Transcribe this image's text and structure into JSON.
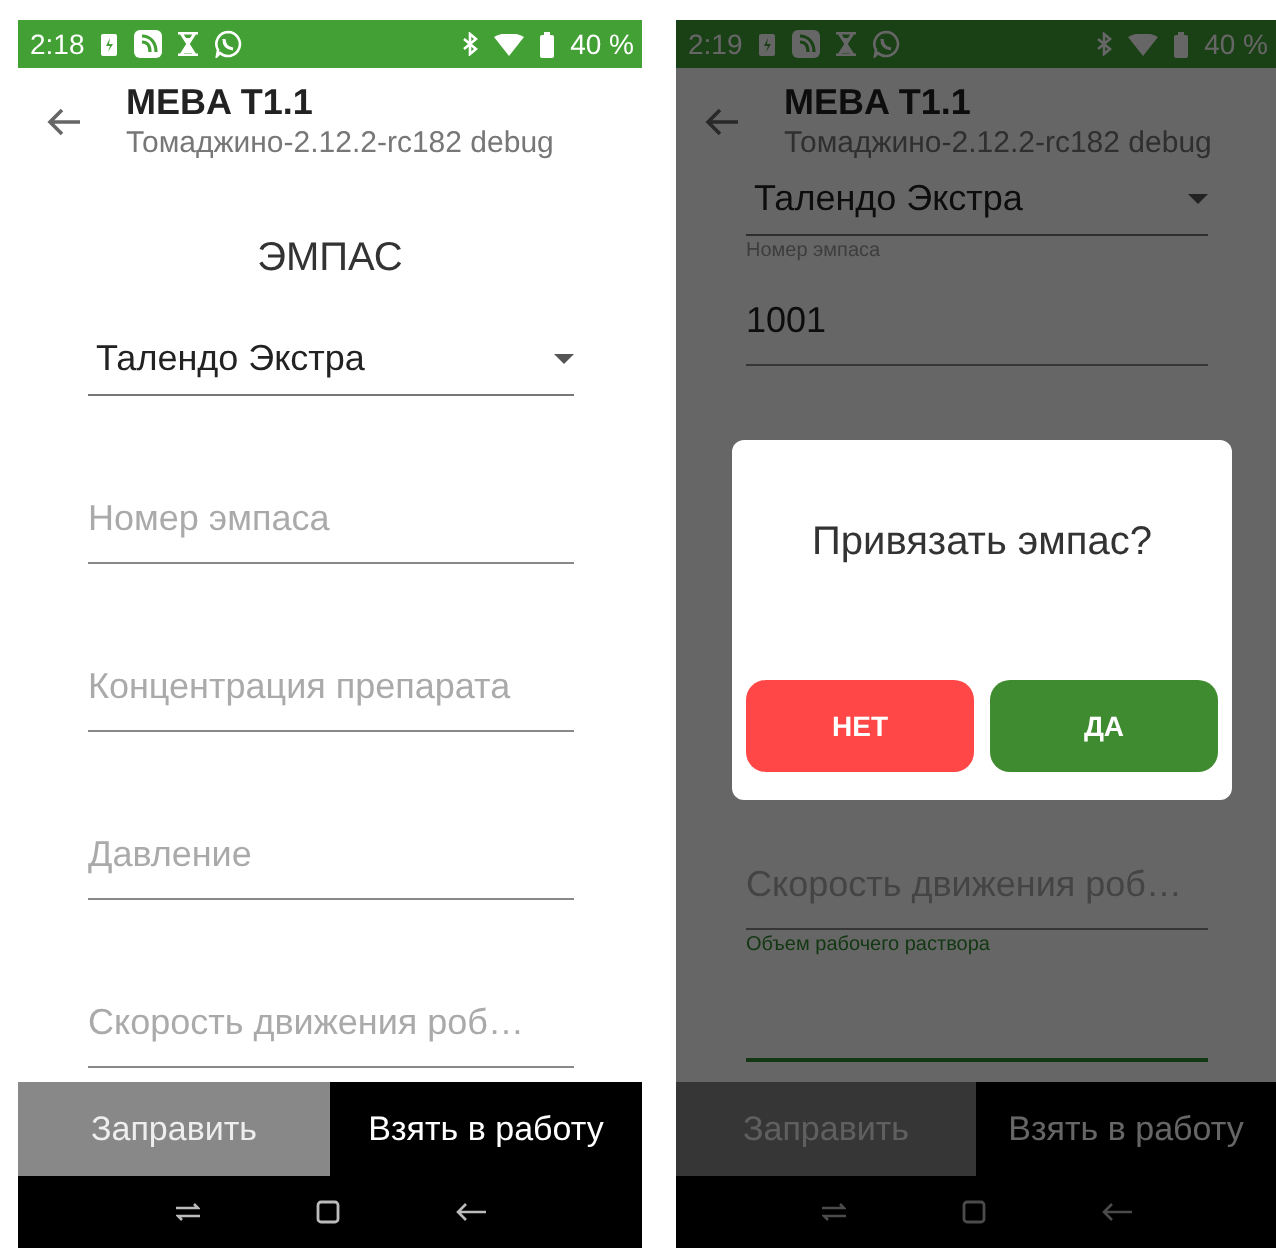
{
  "screens": [
    {
      "status_bar": {
        "time": "2:18",
        "battery": "40 %"
      },
      "app_bar": {
        "title": "MEBA T1.1",
        "subtitle": "Томаджино-2.12.2-rc182 debug"
      },
      "heading": "ЭМПАС",
      "fields": [
        {
          "kind": "dropdown",
          "value": "Талендо Экстра"
        },
        {
          "kind": "input",
          "placeholder": "Номер эмпаса",
          "focused": false
        },
        {
          "kind": "input",
          "placeholder": "Концентрация препарата",
          "focused": false
        },
        {
          "kind": "input",
          "placeholder": "Давление",
          "focused": false
        },
        {
          "kind": "input",
          "placeholder": "Скорость движения роб…",
          "focused": false
        }
      ],
      "bottom_buttons": [
        {
          "label": "Заправить",
          "disabled": true
        },
        {
          "label": "Взять в работу",
          "disabled": false
        }
      ]
    },
    {
      "status_bar": {
        "time": "2:19",
        "battery": "40 %"
      },
      "app_bar": {
        "title": "MEBA T1.1",
        "subtitle": "Томаджино-2.12.2-rc182 debug"
      },
      "fields": [
        {
          "kind": "dropdown",
          "value": "Талендо Экстра"
        },
        {
          "kind": "input",
          "label": "Номер эмпаса",
          "value": "1001",
          "focused": false
        },
        {
          "kind": "input",
          "placeholder": "Скорость движения роб…",
          "focused": false
        },
        {
          "kind": "input",
          "label": "Объем рабочего раствора",
          "focused": true
        }
      ],
      "bottom_buttons": [
        {
          "label": "Заправить",
          "disabled": true
        },
        {
          "label": "Взять в работу",
          "disabled": false
        }
      ],
      "dialog": {
        "message": "Привязать эмпас?",
        "buttons": [
          {
            "label": "НЕТ",
            "kind": "negative"
          },
          {
            "label": "ДА",
            "kind": "positive"
          }
        ]
      }
    }
  ]
}
